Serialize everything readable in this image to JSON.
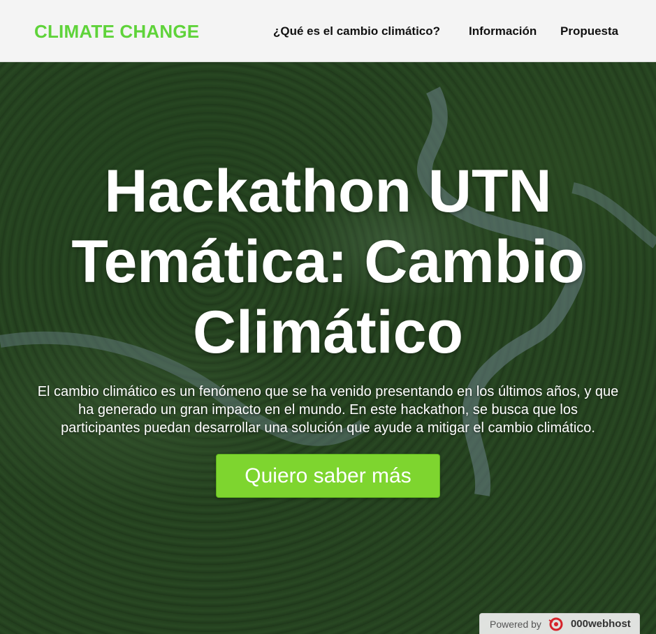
{
  "navbar": {
    "brand": "CLIMATE CHANGE",
    "links": [
      {
        "label": "¿Qué es el cambio climático?"
      },
      {
        "label": "Información"
      },
      {
        "label": "Propuesta"
      }
    ]
  },
  "hero": {
    "title_lines": [
      "Hackathon UTN",
      "Temática: Cambio",
      "Climático"
    ],
    "description_lines": [
      "El cambio climático es un fenómeno que se ha venido presentando en los últimos años, y que",
      "ha generado un gran impacto en el mundo. En este hackathon, se busca que los",
      "participantes puedan desarrollar una solución que ayude a mitigar el cambio climático."
    ],
    "cta_label": "Quiero saber más"
  },
  "badge": {
    "powered_label": "Powered by",
    "host_name": "000webhost"
  },
  "colors": {
    "brand_green": "#5fd33a",
    "cta_green": "#7ed52f",
    "navbar_bg": "#f4f4f4"
  },
  "icons": {
    "badge_logo": "000webhost-logo-icon"
  }
}
